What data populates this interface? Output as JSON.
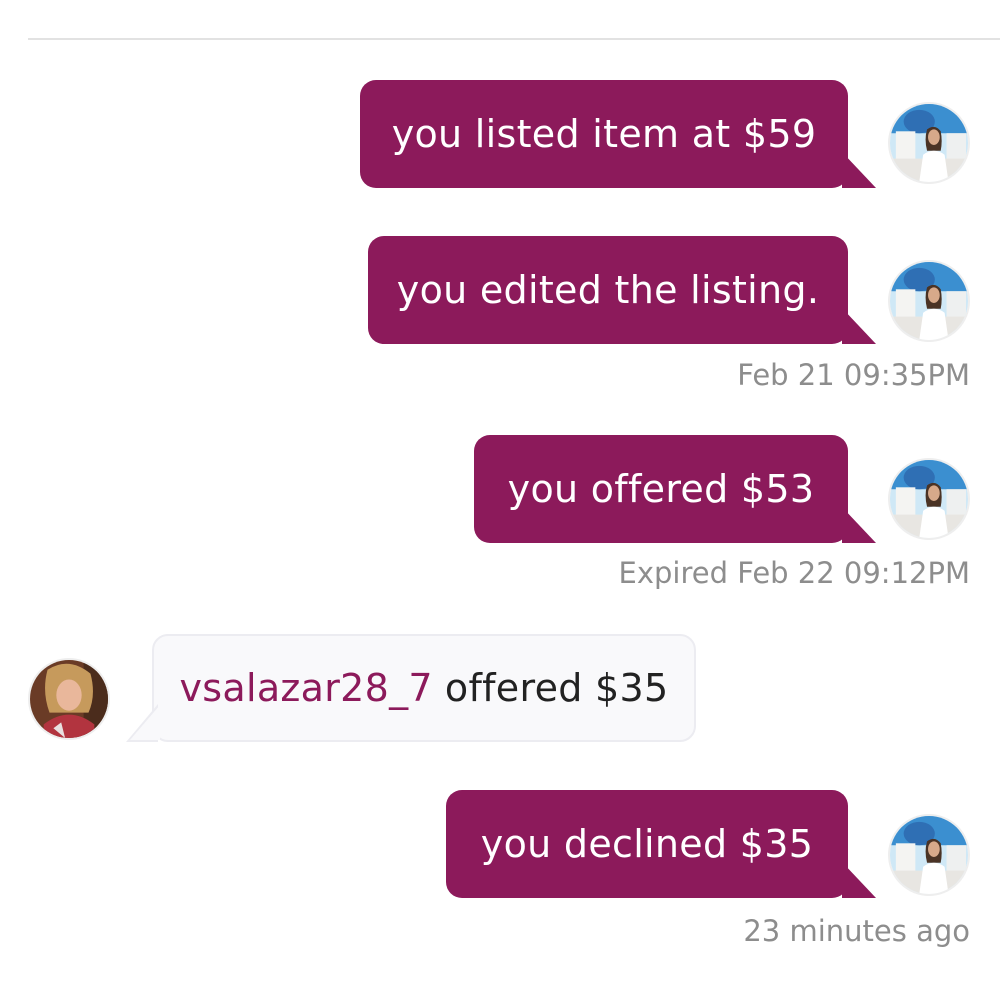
{
  "messages": [
    {
      "text": "you listed item at $59"
    },
    {
      "text": "you edited the listing."
    },
    {
      "text": "you offered $53"
    },
    {
      "username": "vsalazar28_7",
      "text": "offered $35"
    },
    {
      "text": "you declined $35"
    }
  ],
  "timestamps": {
    "edited": "Feb 21 09:35PM",
    "offer_expired": "Expired Feb 22 09:12PM",
    "declined": "23 minutes ago"
  },
  "colors": {
    "outgoing_bubble": "#8c1a5b",
    "incoming_bubble": "#f9f9fb",
    "username": "#8c1a5b",
    "timestamp": "#8d8d8d"
  },
  "icons": {
    "own_avatar": "avatar-photo-woman-seaside",
    "other_avatar": "avatar-photo-woman"
  }
}
